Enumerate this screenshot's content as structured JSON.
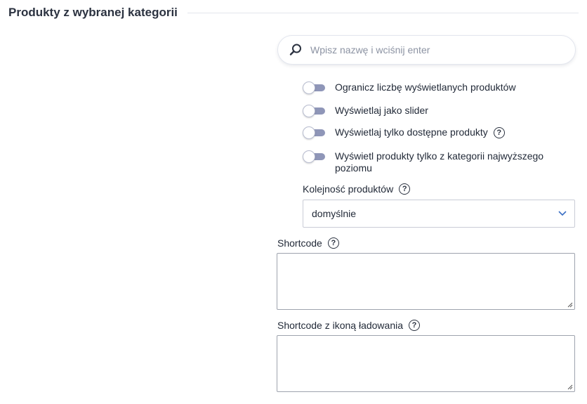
{
  "section": {
    "title": "Produkty z wybranej kategorii"
  },
  "search": {
    "placeholder": "Wpisz nazwę i wciśnij enter",
    "value": ""
  },
  "toggles": [
    {
      "label": "Ogranicz liczbę wyświetlanych produktów",
      "checked": false,
      "help": false
    },
    {
      "label": "Wyświetlaj jako slider",
      "checked": false,
      "help": false
    },
    {
      "label": "Wyświetlaj tylko dostępne produkty",
      "checked": false,
      "help": true
    },
    {
      "label": "Wyświetl produkty tylko z kategorii najwyższego poziomu",
      "checked": false,
      "help": false
    }
  ],
  "order": {
    "label": "Kolejność produktów",
    "selected": "domyślnie"
  },
  "shortcode": {
    "label": "Shortcode",
    "value": ""
  },
  "shortcode_loading": {
    "label": "Shortcode z ikoną ładowania",
    "value": ""
  },
  "help_glyph": "?",
  "colors": {
    "toggle_track": "#8f96b8",
    "border": "#c9ccd6",
    "accent": "#3b6fc4"
  }
}
